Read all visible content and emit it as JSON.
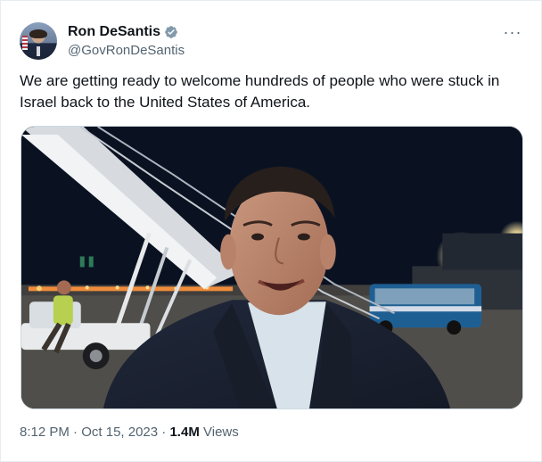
{
  "author": {
    "display_name": "Ron DeSantis",
    "handle": "@GovRonDeSantis",
    "verified": true,
    "avatar_icon": "profile-photo"
  },
  "tweet": {
    "text": "We are getting ready to welcome hundreds of people who were stuck in Israel back to the United States of America."
  },
  "metadata": {
    "time": "8:12 PM",
    "separator": "·",
    "date": "Oct 15, 2023",
    "views_count": "1.4M",
    "views_label": "Views"
  },
  "actions": {
    "more_icon": "more-options-icon",
    "more_label": "···"
  },
  "colors": {
    "primary_text": "#0f1419",
    "secondary_text": "#536471",
    "verified_badge": "#829aab",
    "border": "#cfd9de",
    "background": "#ffffff"
  },
  "media": {
    "type": "video thumbnail",
    "icon": "video-icon"
  }
}
